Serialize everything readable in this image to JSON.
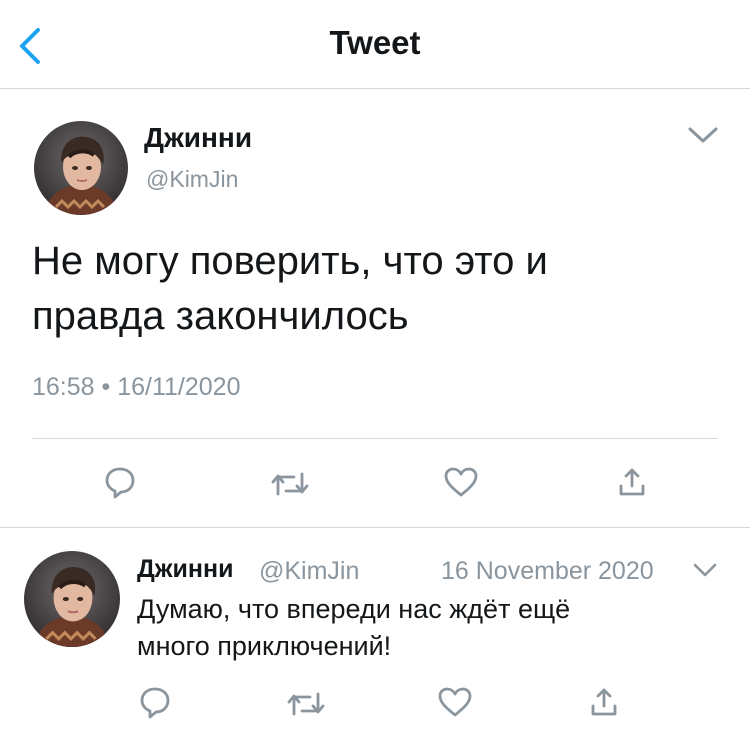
{
  "header": {
    "title": "Tweet"
  },
  "main_tweet": {
    "name": "Джинни",
    "handle": "@KimJin",
    "text_line1": "Не могу поверить, что это и",
    "text_line2": "правда закончилось",
    "timestamp": "16:58 • 16/11/2020"
  },
  "reply_tweet": {
    "name": "Джинни",
    "handle": "@KimJin",
    "date": "16 November 2020",
    "text_line1": "Думаю, что впереди нас ждёт ещё",
    "text_line2": "много приключений!"
  },
  "icons": {
    "back": "chevron-left-icon",
    "more": "chevron-down-icon",
    "reply": "reply-icon",
    "retweet": "retweet-icon",
    "like": "heart-icon",
    "share": "share-icon"
  },
  "colors": {
    "accent": "#1da1f2",
    "text": "#14171a",
    "secondary": "#8a959e",
    "divider": "#d6d9dc"
  }
}
